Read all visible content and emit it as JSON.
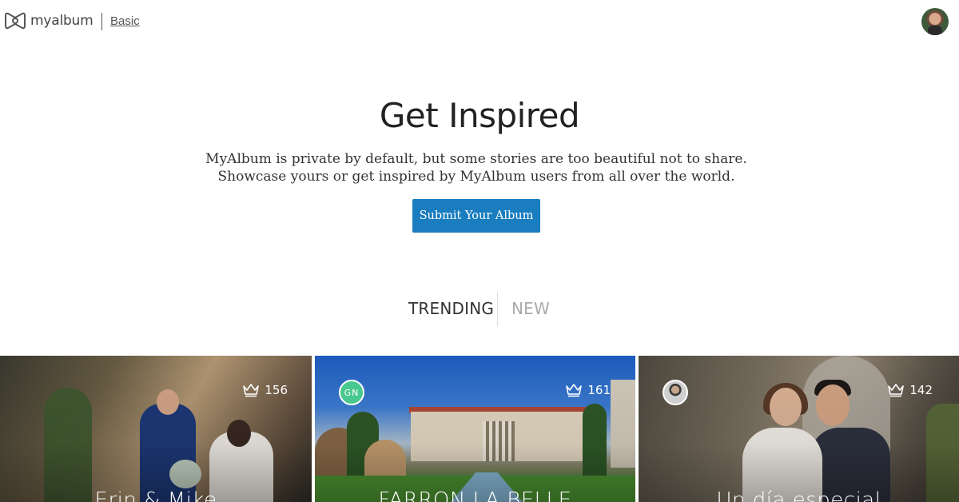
{
  "header": {
    "logo_text": "myalbum",
    "plan_label": "Basic",
    "logo_icon": "myalbum-logo-icon",
    "avatar_icon": "user-avatar"
  },
  "hero": {
    "title": "Get Inspired",
    "description": "MyAlbum is private by default, but some stories are too beautiful not to share. Showcase yours or get inspired by MyAlbum users from all over the world.",
    "submit_label": "Submit Your Album",
    "submit_color": "#1a7dbf"
  },
  "tabs": [
    {
      "label": "TRENDING",
      "active": true
    },
    {
      "label": "NEW",
      "active": false
    }
  ],
  "albums": [
    {
      "title": "Erin & Mike",
      "likes": "156",
      "owner_badge": null,
      "like_icon": "crown-icon"
    },
    {
      "title": "FARRON LA BELLE",
      "likes": "161",
      "owner_badge": "GN",
      "owner_badge_color": "#48c78e",
      "like_icon": "crown-icon"
    },
    {
      "title": "Un día especial",
      "likes": "142",
      "owner_badge": "photo",
      "like_icon": "crown-icon"
    }
  ]
}
